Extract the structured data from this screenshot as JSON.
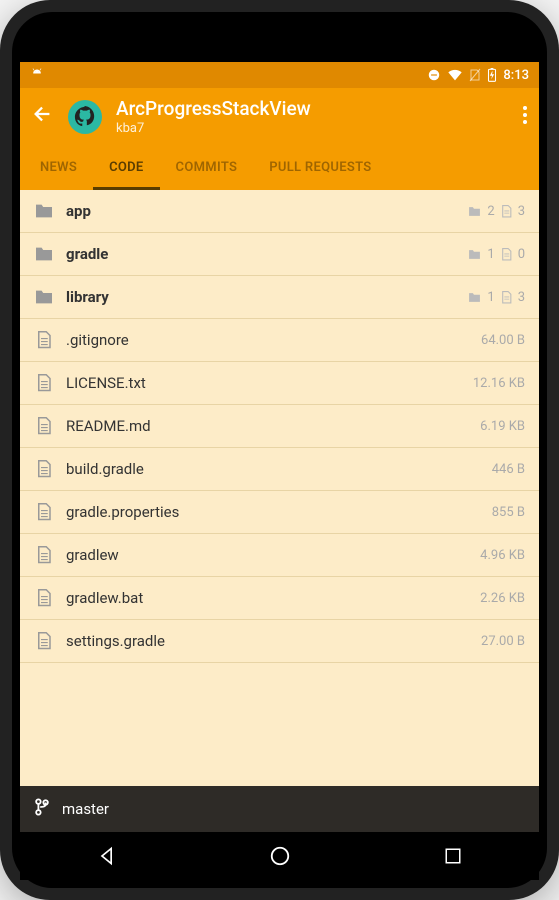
{
  "statusbar": {
    "time": "8:13"
  },
  "header": {
    "title": "ArcProgressStackView",
    "subtitle": "kba7"
  },
  "tabs": [
    {
      "label": "NEWS",
      "active": false
    },
    {
      "label": "CODE",
      "active": true
    },
    {
      "label": "COMMITS",
      "active": false
    },
    {
      "label": "PULL REQUESTS",
      "active": false
    }
  ],
  "files": [
    {
      "name": "app",
      "type": "dir",
      "dirs": "2",
      "files": "3"
    },
    {
      "name": "gradle",
      "type": "dir",
      "dirs": "1",
      "files": "0"
    },
    {
      "name": "library",
      "type": "dir",
      "dirs": "1",
      "files": "3"
    },
    {
      "name": ".gitignore",
      "type": "file",
      "size": "64.00 B"
    },
    {
      "name": "LICENSE.txt",
      "type": "file",
      "size": "12.16 KB"
    },
    {
      "name": "README.md",
      "type": "file",
      "size": "6.19 KB"
    },
    {
      "name": "build.gradle",
      "type": "file",
      "size": "446 B"
    },
    {
      "name": "gradle.properties",
      "type": "file",
      "size": "855 B"
    },
    {
      "name": "gradlew",
      "type": "file",
      "size": "4.96 KB"
    },
    {
      "name": "gradlew.bat",
      "type": "file",
      "size": "2.26 KB"
    },
    {
      "name": "settings.gradle",
      "type": "file",
      "size": "27.00 B"
    }
  ],
  "branch": {
    "name": "master"
  }
}
